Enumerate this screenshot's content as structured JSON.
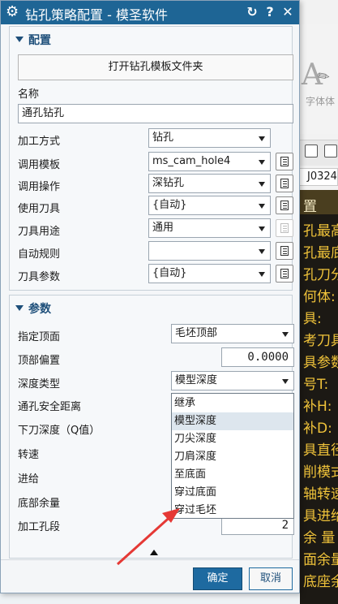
{
  "background": {
    "font_label": "字体体",
    "code_value": "J0324",
    "panel_header": "置",
    "panel_lines": [
      "孔最高",
      "孔最底",
      "孔刀分",
      "何体:",
      "具:",
      "考刀具",
      "具参数",
      "号T:",
      "补H:",
      "补D:",
      "具直径",
      "削模式",
      "轴转速",
      "具进给",
      "余 量",
      "面余量",
      "底座余"
    ]
  },
  "dialog": {
    "title": "钻孔策略配置 - 模圣软件",
    "title_buttons": {
      "reset": "↻",
      "help": "?",
      "close": "✕"
    },
    "config_section": {
      "header": "配置",
      "open_folder_button": "打开钻孔模板文件夹",
      "name_label": "名称",
      "name_value": "通孔钻孔",
      "rows": [
        {
          "label": "加工方式",
          "value": "钻孔",
          "has_list_button": false
        },
        {
          "label": "调用模板",
          "value": "ms_cam_hole4",
          "has_list_button": true
        },
        {
          "label": "调用操作",
          "value": "深钻孔",
          "has_list_button": true
        },
        {
          "label": "使用刀具",
          "value": "{自动}",
          "has_list_button": true
        },
        {
          "label": "刀具用途",
          "value": "通用",
          "has_list_button": true
        },
        {
          "label": "自动规则",
          "value": "",
          "has_list_button": true
        },
        {
          "label": "刀具参数",
          "value": "{自动}",
          "has_list_button": true
        }
      ]
    },
    "params_section": {
      "header": "参数",
      "top_label": "指定顶面",
      "top_value": "毛坯顶部",
      "offset_label": "顶部偏置",
      "offset_value": "0.0000",
      "depth_type_label": "深度类型",
      "depth_type_value": "模型深度",
      "other_labels": [
        "通孔安全距离",
        "下刀深度（Q值）",
        "转速",
        "进给",
        "底部余量",
        "加工孔段"
      ],
      "hole_segment_value": "2",
      "depth_type_options": [
        "继承",
        "模型深度",
        "刀尖深度",
        "刀肩深度",
        "至底面",
        "穿过底面",
        "穿过毛坯"
      ],
      "depth_type_selected_index": 1
    },
    "footer": {
      "ok_label": "确定",
      "cancel_label": "取消"
    }
  },
  "colors": {
    "titlebar": "#1e6595",
    "section_header": "#1e4f7a",
    "ok_button": "#1e6aa0",
    "annotation_arrow": "#e53935",
    "background_text": "#f0c33a"
  }
}
